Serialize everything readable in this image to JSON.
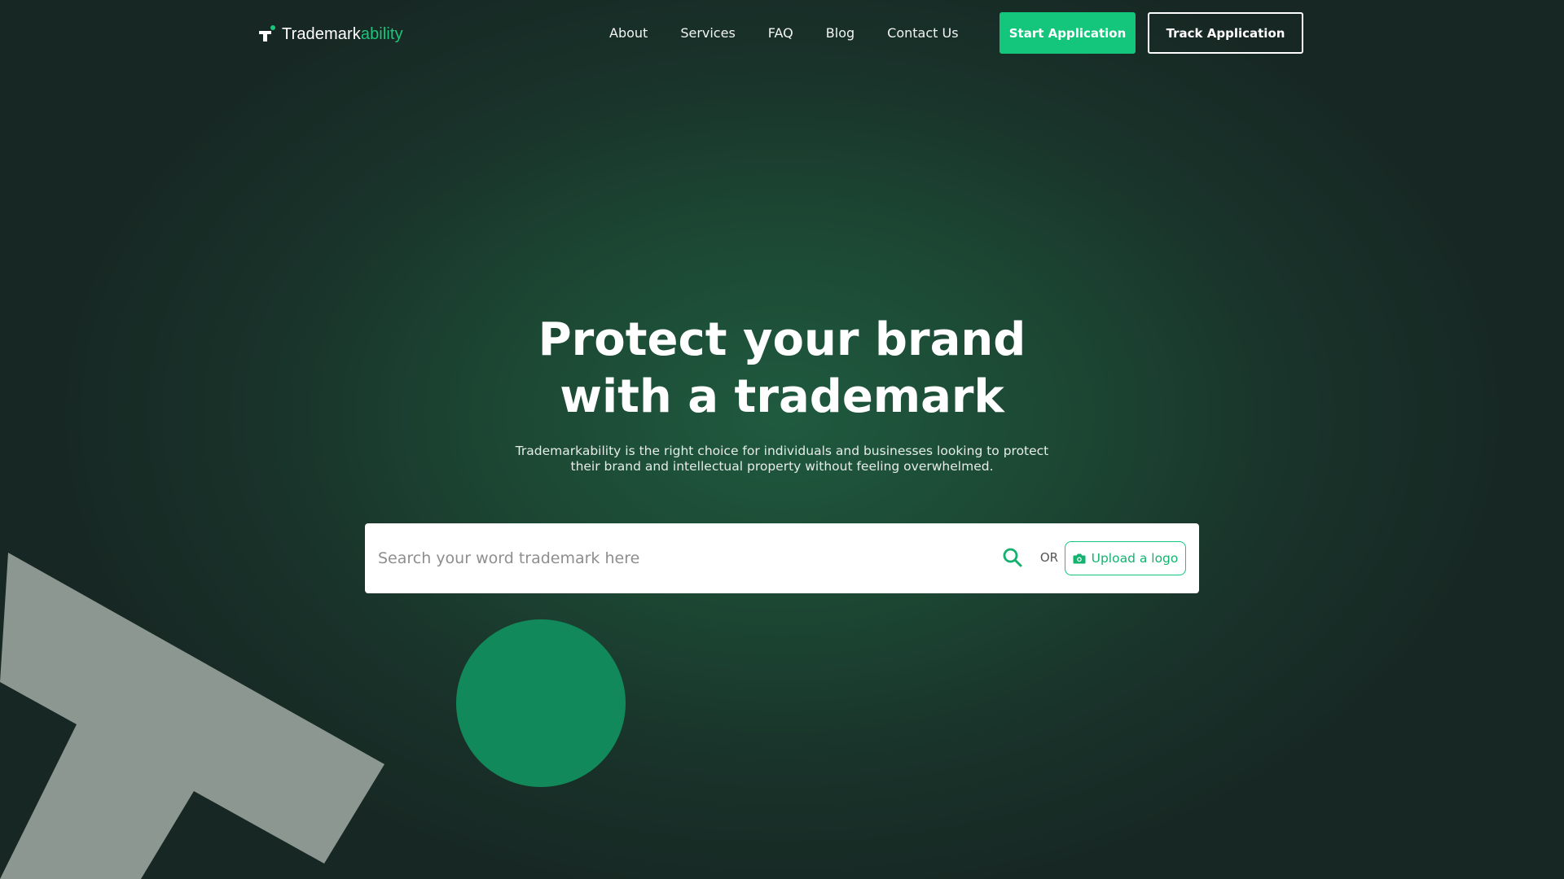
{
  "brand": {
    "name_main": "Trademark",
    "name_accent": "ability",
    "logo_icon": "trademark-t-icon",
    "accent_color": "#1ec47c"
  },
  "nav": {
    "items": [
      {
        "label": "About"
      },
      {
        "label": "Services"
      },
      {
        "label": "FAQ"
      },
      {
        "label": "Blog"
      },
      {
        "label": "Contact Us"
      }
    ]
  },
  "header": {
    "start_label": "Start Application",
    "track_label": "Track Application"
  },
  "hero": {
    "title_line1": "Protect your brand",
    "title_line2": "with a trademark",
    "subtitle_line1": "Trademarkability is the right choice for individuals and businesses looking to protect",
    "subtitle_line2": "their brand and intellectual property without feeling overwhelmed."
  },
  "search": {
    "placeholder": "Search your word trademark here",
    "value": "",
    "search_icon": "search-icon",
    "or_label": "OR",
    "upload_label": "Upload a logo",
    "upload_icon": "camera-icon"
  },
  "colors": {
    "primary_green": "#14c67c",
    "background_dark": "#172723",
    "decor_gray": "#8a9590",
    "decor_circle": "#12895a"
  }
}
